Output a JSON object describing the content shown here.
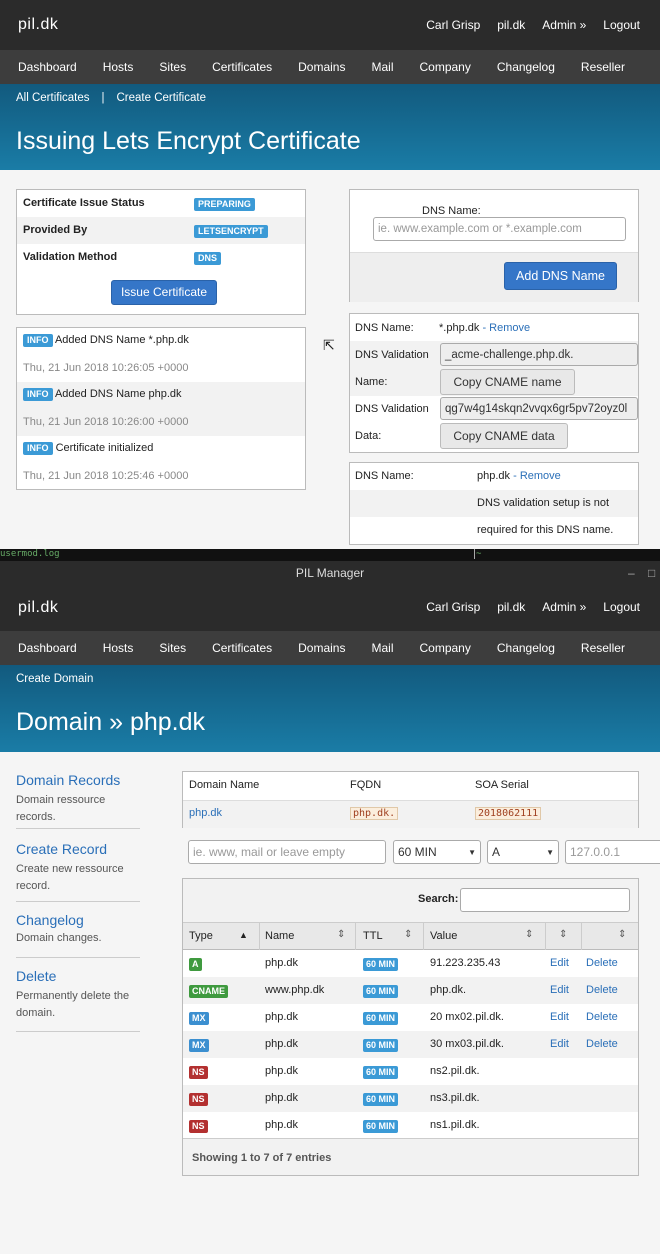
{
  "top": {
    "logo": "pil.dk",
    "nav": [
      "Carl Grisp",
      "pil.dk",
      "Admin »",
      "Logout"
    ]
  },
  "menu": [
    "Dashboard",
    "Hosts",
    "Sites",
    "Certificates",
    "Domains",
    "Mail",
    "Company",
    "Changelog",
    "Reseller"
  ],
  "cert": {
    "sub": [
      "All Certificates",
      "|",
      "Create Certificate"
    ],
    "title": "Issuing Lets Encrypt Certificate",
    "status_label": "Certificate Issue Status",
    "status": "PREPARING",
    "provided_label": "Provided By",
    "provided": "LETSENCRYPT",
    "method_label": "Validation Method",
    "method": "DNS",
    "issue_btn": "Issue Certificate",
    "log": [
      {
        "badge": "INFO",
        "msg": "Added DNS Name *.php.dk",
        "time": "Thu, 21 Jun 2018 10:26:05 +0000"
      },
      {
        "badge": "INFO",
        "msg": "Added DNS Name php.dk",
        "time": "Thu, 21 Jun 2018 10:26:00 +0000"
      },
      {
        "badge": "INFO",
        "msg": "Certificate initialized",
        "time": "Thu, 21 Jun 2018 10:25:46 +0000"
      }
    ],
    "dns_label": "DNS Name:",
    "dns_placeholder": "ie. www.example.com or *.example.com",
    "add_btn": "Add DNS Name",
    "e1": {
      "name_label": "DNS Name:",
      "name": "*.php.dk",
      "remove": "- Remove",
      "vn_label1": "DNS Validation",
      "vn_label2": "Name:",
      "vn_value": "_acme-challenge.php.dk.",
      "copy_name": "Copy CNAME name",
      "vd_label1": "DNS Validation",
      "vd_label2": "Data:",
      "vd_value": "qg7w4g14skqn2vvqx6gr5pv72oyz0l",
      "copy_data": "Copy CNAME data"
    },
    "e2": {
      "name_label": "DNS Name:",
      "name": "php.dk",
      "remove": "- Remove",
      "note1": "DNS validation setup is not",
      "note2": "required for this DNS name."
    }
  },
  "term": {
    "left": "usermod.log",
    "right": "~"
  },
  "window_title": "PIL Manager",
  "domain": {
    "sub": "Create Domain",
    "title": "Domain » php.dk",
    "side": [
      {
        "title": "Domain Records",
        "desc1": "Domain ressource",
        "desc2": "records."
      },
      {
        "title": "Create Record",
        "desc1": "Create new ressource",
        "desc2": "record."
      },
      {
        "title": "Changelog",
        "desc1": "Domain changes.",
        "desc2": ""
      },
      {
        "title": "Delete",
        "desc1": "Permanently delete the",
        "desc2": "domain."
      }
    ],
    "info_headers": [
      "Domain Name",
      "FQDN",
      "SOA Serial"
    ],
    "info_values": [
      "php.dk",
      "php.dk.",
      "2018062111"
    ],
    "form": {
      "name_placeholder": "ie. www, mail or leave empty",
      "ttl": "60 MIN",
      "type": "A",
      "value_placeholder": "127.0.0.1"
    },
    "search_label": "Search:",
    "headers": [
      "Type",
      "Name",
      "TTL",
      "Value"
    ],
    "rows": [
      {
        "type": "A",
        "name": "php.dk",
        "ttl": "60 MIN",
        "value": "91.223.235.43",
        "edit": "Edit",
        "del": "Delete",
        "color": "#3f9a3f"
      },
      {
        "type": "CNAME",
        "name": "www.php.dk",
        "ttl": "60 MIN",
        "value": "php.dk.",
        "edit": "Edit",
        "del": "Delete",
        "color": "#3f9a3f"
      },
      {
        "type": "MX",
        "name": "php.dk",
        "ttl": "60 MIN",
        "value": "20 mx02.pil.dk.",
        "edit": "Edit",
        "del": "Delete",
        "color": "#3b8fd0"
      },
      {
        "type": "MX",
        "name": "php.dk",
        "ttl": "60 MIN",
        "value": "30 mx03.pil.dk.",
        "edit": "Edit",
        "del": "Delete",
        "color": "#3b8fd0"
      },
      {
        "type": "NS",
        "name": "php.dk",
        "ttl": "60 MIN",
        "value": "ns2.pil.dk.",
        "edit": "",
        "del": "",
        "color": "#b33030"
      },
      {
        "type": "NS",
        "name": "php.dk",
        "ttl": "60 MIN",
        "value": "ns3.pil.dk.",
        "edit": "",
        "del": "",
        "color": "#b33030"
      },
      {
        "type": "NS",
        "name": "php.dk",
        "ttl": "60 MIN",
        "value": "ns1.pil.dk.",
        "edit": "",
        "del": "",
        "color": "#b33030"
      }
    ],
    "footer": "Showing 1 to 7 of 7 entries"
  }
}
